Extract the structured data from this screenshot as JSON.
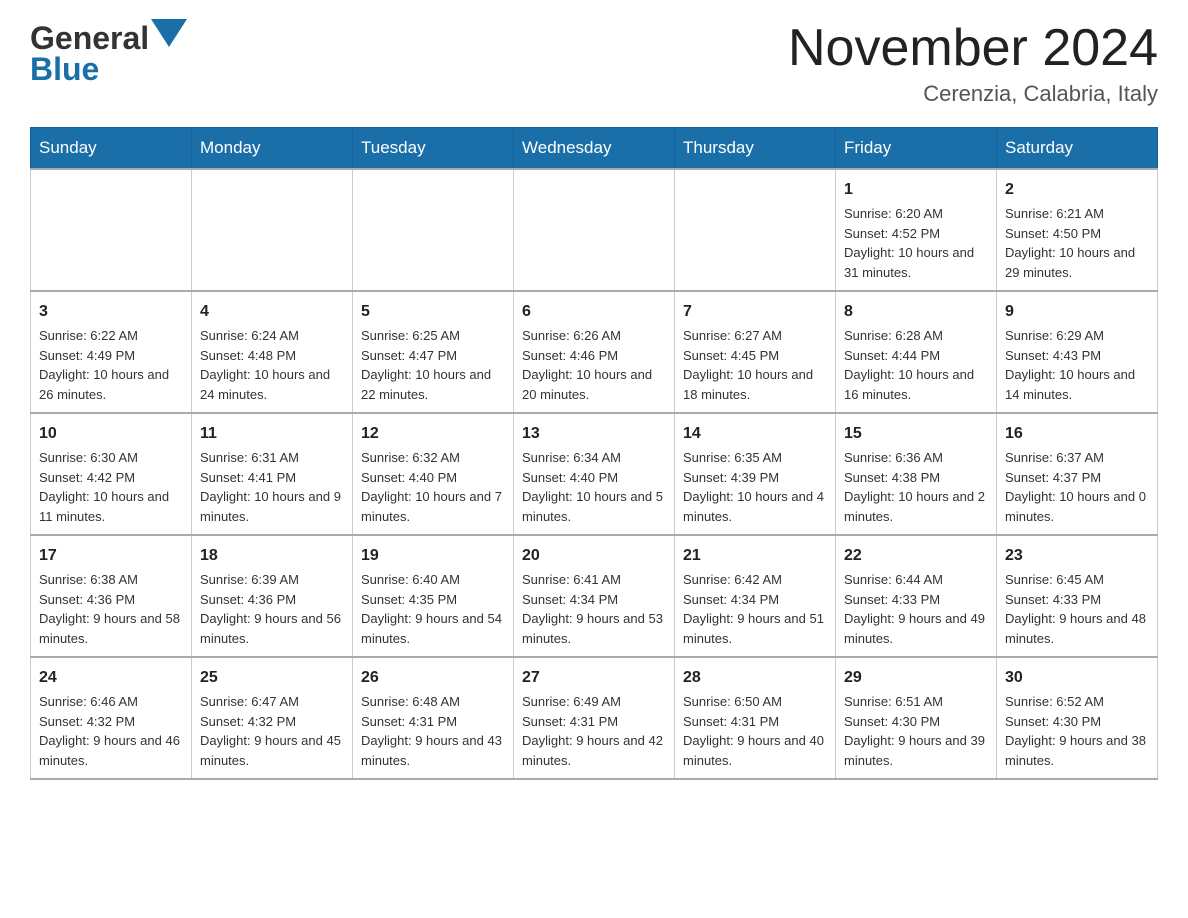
{
  "header": {
    "logo_main": "General",
    "logo_sub": "Blue",
    "month_title": "November 2024",
    "location": "Cerenzia, Calabria, Italy"
  },
  "weekdays": [
    "Sunday",
    "Monday",
    "Tuesday",
    "Wednesday",
    "Thursday",
    "Friday",
    "Saturday"
  ],
  "weeks": [
    [
      {
        "day": "",
        "info": ""
      },
      {
        "day": "",
        "info": ""
      },
      {
        "day": "",
        "info": ""
      },
      {
        "day": "",
        "info": ""
      },
      {
        "day": "",
        "info": ""
      },
      {
        "day": "1",
        "info": "Sunrise: 6:20 AM\nSunset: 4:52 PM\nDaylight: 10 hours and 31 minutes."
      },
      {
        "day": "2",
        "info": "Sunrise: 6:21 AM\nSunset: 4:50 PM\nDaylight: 10 hours and 29 minutes."
      }
    ],
    [
      {
        "day": "3",
        "info": "Sunrise: 6:22 AM\nSunset: 4:49 PM\nDaylight: 10 hours and 26 minutes."
      },
      {
        "day": "4",
        "info": "Sunrise: 6:24 AM\nSunset: 4:48 PM\nDaylight: 10 hours and 24 minutes."
      },
      {
        "day": "5",
        "info": "Sunrise: 6:25 AM\nSunset: 4:47 PM\nDaylight: 10 hours and 22 minutes."
      },
      {
        "day": "6",
        "info": "Sunrise: 6:26 AM\nSunset: 4:46 PM\nDaylight: 10 hours and 20 minutes."
      },
      {
        "day": "7",
        "info": "Sunrise: 6:27 AM\nSunset: 4:45 PM\nDaylight: 10 hours and 18 minutes."
      },
      {
        "day": "8",
        "info": "Sunrise: 6:28 AM\nSunset: 4:44 PM\nDaylight: 10 hours and 16 minutes."
      },
      {
        "day": "9",
        "info": "Sunrise: 6:29 AM\nSunset: 4:43 PM\nDaylight: 10 hours and 14 minutes."
      }
    ],
    [
      {
        "day": "10",
        "info": "Sunrise: 6:30 AM\nSunset: 4:42 PM\nDaylight: 10 hours and 11 minutes."
      },
      {
        "day": "11",
        "info": "Sunrise: 6:31 AM\nSunset: 4:41 PM\nDaylight: 10 hours and 9 minutes."
      },
      {
        "day": "12",
        "info": "Sunrise: 6:32 AM\nSunset: 4:40 PM\nDaylight: 10 hours and 7 minutes."
      },
      {
        "day": "13",
        "info": "Sunrise: 6:34 AM\nSunset: 4:40 PM\nDaylight: 10 hours and 5 minutes."
      },
      {
        "day": "14",
        "info": "Sunrise: 6:35 AM\nSunset: 4:39 PM\nDaylight: 10 hours and 4 minutes."
      },
      {
        "day": "15",
        "info": "Sunrise: 6:36 AM\nSunset: 4:38 PM\nDaylight: 10 hours and 2 minutes."
      },
      {
        "day": "16",
        "info": "Sunrise: 6:37 AM\nSunset: 4:37 PM\nDaylight: 10 hours and 0 minutes."
      }
    ],
    [
      {
        "day": "17",
        "info": "Sunrise: 6:38 AM\nSunset: 4:36 PM\nDaylight: 9 hours and 58 minutes."
      },
      {
        "day": "18",
        "info": "Sunrise: 6:39 AM\nSunset: 4:36 PM\nDaylight: 9 hours and 56 minutes."
      },
      {
        "day": "19",
        "info": "Sunrise: 6:40 AM\nSunset: 4:35 PM\nDaylight: 9 hours and 54 minutes."
      },
      {
        "day": "20",
        "info": "Sunrise: 6:41 AM\nSunset: 4:34 PM\nDaylight: 9 hours and 53 minutes."
      },
      {
        "day": "21",
        "info": "Sunrise: 6:42 AM\nSunset: 4:34 PM\nDaylight: 9 hours and 51 minutes."
      },
      {
        "day": "22",
        "info": "Sunrise: 6:44 AM\nSunset: 4:33 PM\nDaylight: 9 hours and 49 minutes."
      },
      {
        "day": "23",
        "info": "Sunrise: 6:45 AM\nSunset: 4:33 PM\nDaylight: 9 hours and 48 minutes."
      }
    ],
    [
      {
        "day": "24",
        "info": "Sunrise: 6:46 AM\nSunset: 4:32 PM\nDaylight: 9 hours and 46 minutes."
      },
      {
        "day": "25",
        "info": "Sunrise: 6:47 AM\nSunset: 4:32 PM\nDaylight: 9 hours and 45 minutes."
      },
      {
        "day": "26",
        "info": "Sunrise: 6:48 AM\nSunset: 4:31 PM\nDaylight: 9 hours and 43 minutes."
      },
      {
        "day": "27",
        "info": "Sunrise: 6:49 AM\nSunset: 4:31 PM\nDaylight: 9 hours and 42 minutes."
      },
      {
        "day": "28",
        "info": "Sunrise: 6:50 AM\nSunset: 4:31 PM\nDaylight: 9 hours and 40 minutes."
      },
      {
        "day": "29",
        "info": "Sunrise: 6:51 AM\nSunset: 4:30 PM\nDaylight: 9 hours and 39 minutes."
      },
      {
        "day": "30",
        "info": "Sunrise: 6:52 AM\nSunset: 4:30 PM\nDaylight: 9 hours and 38 minutes."
      }
    ]
  ]
}
